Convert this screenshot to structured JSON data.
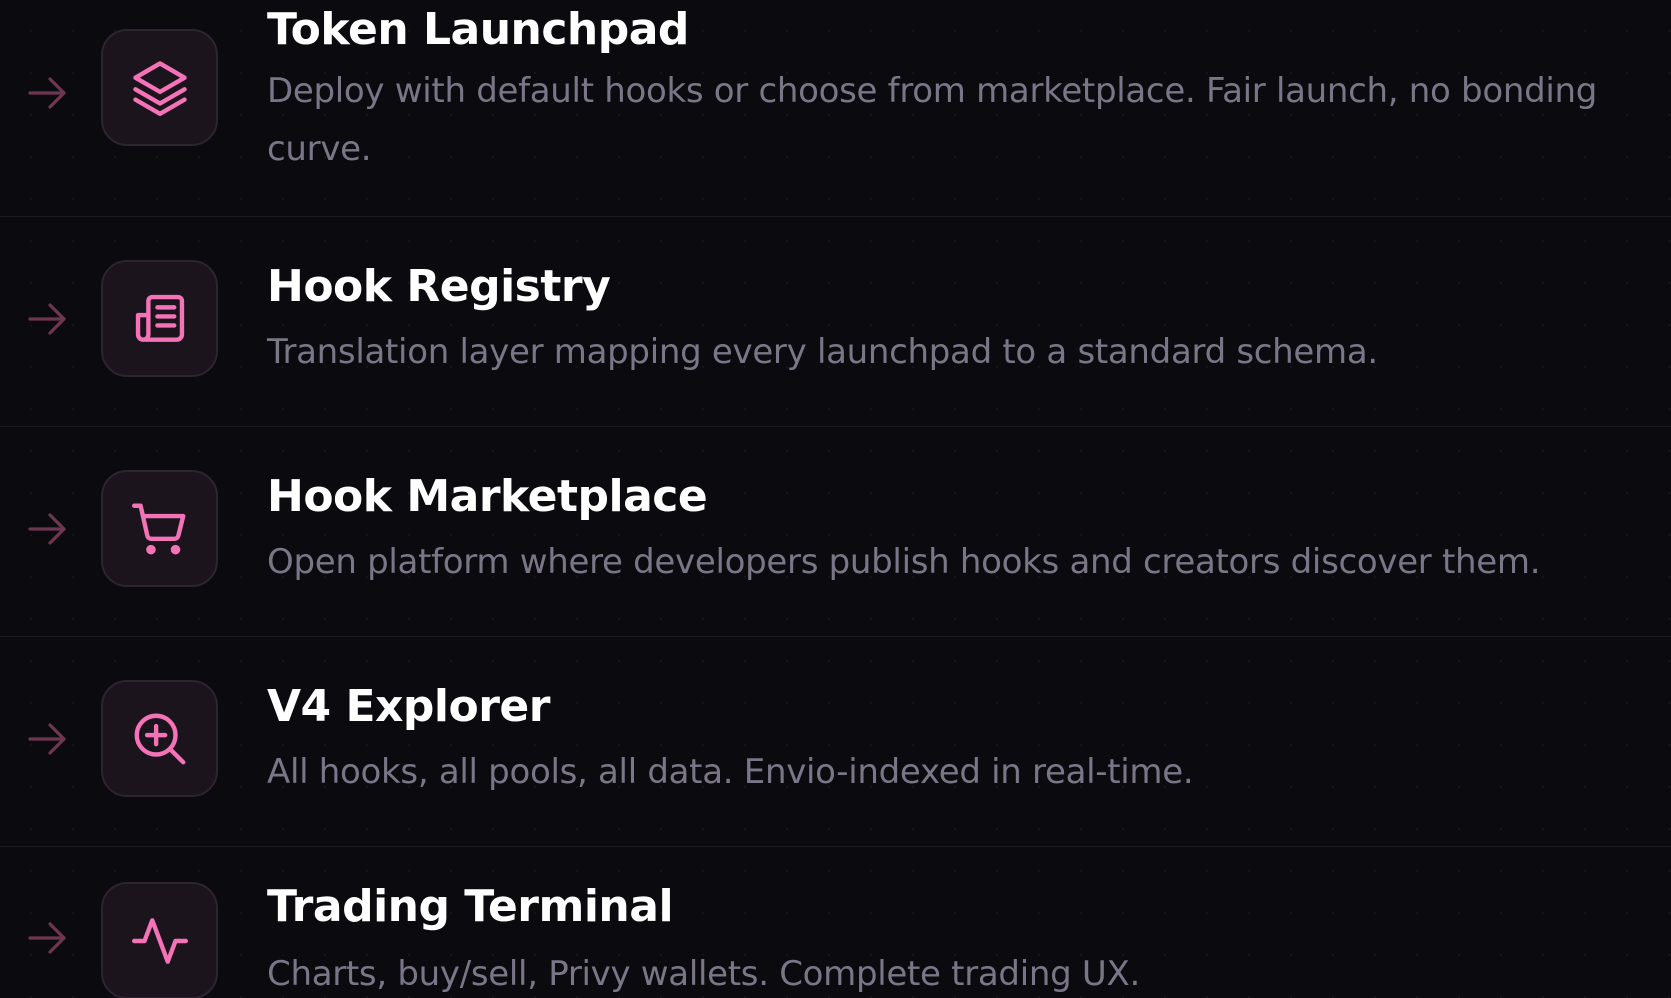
{
  "colors": {
    "background": "#0b0a0f",
    "accent": "#f472b6",
    "arrow": "#6e3650",
    "icon_box_bg": "#1b141d",
    "icon_box_border": "#2c2431",
    "title": "#ffffff",
    "description": "#7a7687",
    "divider": "#1b1a22"
  },
  "features": [
    {
      "title": "Token Launchpad",
      "description": "Deploy with default hooks or choose from marketplace. Fair launch, no bonding curve.",
      "icon": "layers-icon"
    },
    {
      "title": "Hook Registry",
      "description": "Translation layer mapping every launchpad to a standard schema.",
      "icon": "newspaper-icon"
    },
    {
      "title": "Hook Marketplace",
      "description": "Open platform where developers publish hooks and creators discover them.",
      "icon": "shopping-cart-icon"
    },
    {
      "title": "V4 Explorer",
      "description": "All hooks, all pools, all data. Envio-indexed in real-time.",
      "icon": "zoom-in-icon"
    },
    {
      "title": "Trading Terminal",
      "description": "Charts, buy/sell, Privy wallets. Complete trading UX.",
      "icon": "activity-pulse-icon"
    }
  ]
}
